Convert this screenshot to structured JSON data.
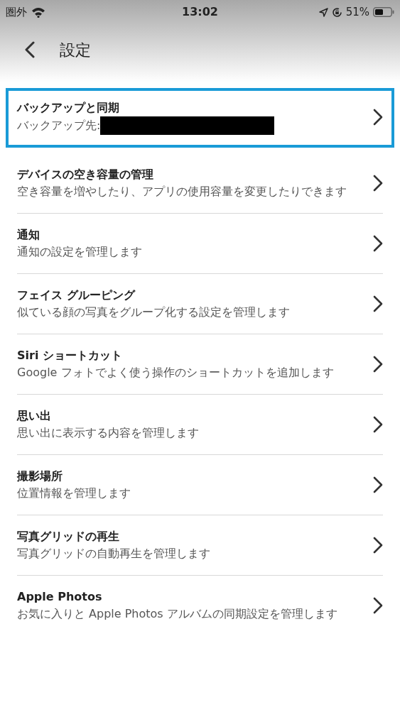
{
  "status_bar": {
    "carrier": "圏外",
    "time": "13:02",
    "battery": "51%"
  },
  "header": {
    "title": "設定"
  },
  "items": [
    {
      "title": "バックアップと同期",
      "subtitle": "バックアップ先:",
      "selected": true,
      "redacted": true
    },
    {
      "title": "デバイスの空き容量の管理",
      "subtitle": "空き容量を増やしたり、アプリの使用容量を変更したりできます",
      "selected": false,
      "redacted": false
    },
    {
      "title": "通知",
      "subtitle": "通知の設定を管理します",
      "selected": false,
      "redacted": false
    },
    {
      "title": "フェイス グルーピング",
      "subtitle": "似ている顔の写真をグループ化する設定を管理します",
      "selected": false,
      "redacted": false
    },
    {
      "title": "Siri ショートカット",
      "subtitle": "Google フォトでよく使う操作のショートカットを追加します",
      "selected": false,
      "redacted": false
    },
    {
      "title": "思い出",
      "subtitle": "思い出に表示する内容を管理します",
      "selected": false,
      "redacted": false
    },
    {
      "title": "撮影場所",
      "subtitle": "位置情報を管理します",
      "selected": false,
      "redacted": false
    },
    {
      "title": "写真グリッドの再生",
      "subtitle": "写真グリッドの自動再生を管理します",
      "selected": false,
      "redacted": false
    },
    {
      "title": "Apple Photos",
      "subtitle": "お気に入りと Apple Photos アルバムの同期設定を管理します",
      "selected": false,
      "redacted": false
    }
  ]
}
